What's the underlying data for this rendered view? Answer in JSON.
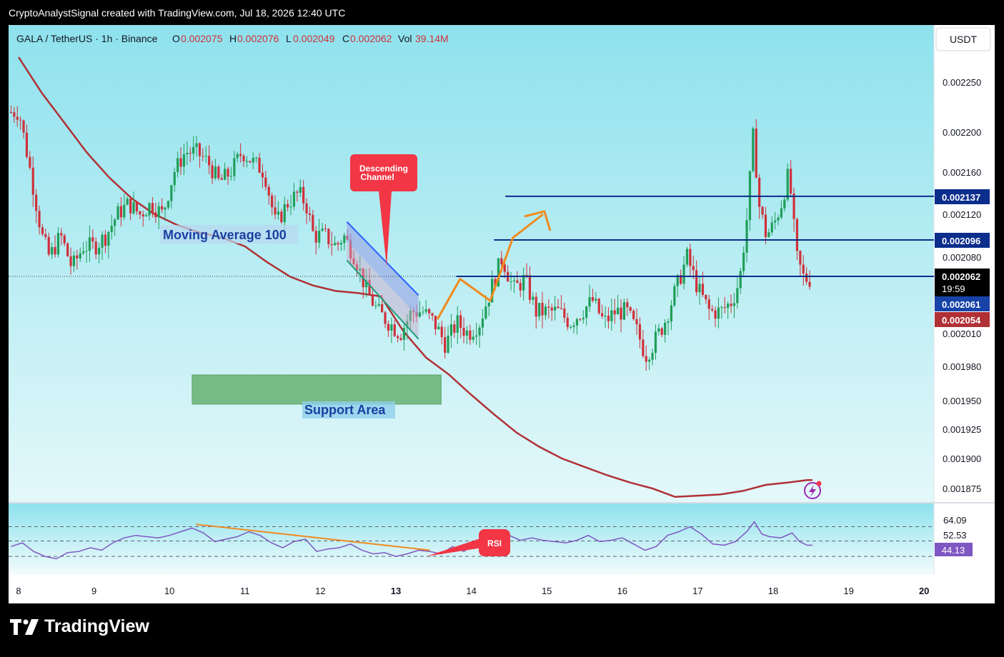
{
  "header": {
    "title": "CryptoAnalystSignal created with TradingView.com, Jul 18, 2026 12:40 UTC"
  },
  "legend": {
    "symbol": "GALA / TetherUS · 1h · Binance",
    "o_label": "O",
    "o_value": "0.002075",
    "h_label": "H",
    "h_value": "0.002076",
    "l_label": "L",
    "l_value": "0.002049",
    "c_label": "C",
    "c_value": "0.002062",
    "vol_label": "Vol",
    "vol_value": "39.14M"
  },
  "currency_button": "USDT",
  "brand": {
    "name": "TradingView"
  },
  "colors": {
    "bg_top": "#8ee2ed",
    "bg_bottom": "#e4f8fa",
    "bull": "#1f9e58",
    "bear": "#d0303a",
    "ma": "#b03035",
    "level": "#0b2d8c",
    "arrow": "#f08a1e",
    "rsi": "#7e57c2",
    "callout": "#f23645"
  },
  "annotations": {
    "moving_average": "Moving Average 100",
    "support_area": "Support Area",
    "descending_channel_line1": "Descending",
    "descending_channel_line2": "Channel",
    "rsi": "RSI"
  },
  "chart_data": {
    "type": "candlestick",
    "y_axis": {
      "range": [
        0.00186,
        0.00228
      ],
      "ticks": [
        "0.002250",
        "0.002200",
        "0.002160",
        "0.002120",
        "0.002080",
        "0.002010",
        "0.001980",
        "0.001950",
        "0.001925",
        "0.001900",
        "0.001875"
      ]
    },
    "x_axis": {
      "range_days": [
        7.9,
        20.05
      ],
      "ticks": [
        {
          "label": "8",
          "x": 8,
          "bold": false
        },
        {
          "label": "9",
          "x": 9,
          "bold": false
        },
        {
          "label": "10",
          "x": 10,
          "bold": false
        },
        {
          "label": "11",
          "x": 11,
          "bold": false
        },
        {
          "label": "12",
          "x": 12,
          "bold": false
        },
        {
          "label": "13",
          "x": 13,
          "bold": true
        },
        {
          "label": "14",
          "x": 14,
          "bold": false
        },
        {
          "label": "15",
          "x": 15,
          "bold": false
        },
        {
          "label": "16",
          "x": 16,
          "bold": false
        },
        {
          "label": "17",
          "x": 17,
          "bold": false
        },
        {
          "label": "18",
          "x": 18,
          "bold": false
        },
        {
          "label": "19",
          "x": 19,
          "bold": false
        },
        {
          "label": "20",
          "x": 20,
          "bold": true
        }
      ]
    },
    "price_path": [
      [
        7.9,
        0.00222
      ],
      [
        8.05,
        0.00222
      ],
      [
        8.15,
        0.00218
      ],
      [
        8.25,
        0.00214
      ],
      [
        8.35,
        0.0021
      ],
      [
        8.45,
        0.00208
      ],
      [
        8.6,
        0.0021
      ],
      [
        8.75,
        0.00207
      ],
      [
        8.9,
        0.00209
      ],
      [
        9.05,
        0.00209
      ],
      [
        9.2,
        0.0021
      ],
      [
        9.35,
        0.00212
      ],
      [
        9.5,
        0.00213
      ],
      [
        9.65,
        0.00212
      ],
      [
        9.8,
        0.00213
      ],
      [
        9.95,
        0.00212
      ],
      [
        10.1,
        0.00216
      ],
      [
        10.25,
        0.00218
      ],
      [
        10.4,
        0.00218
      ],
      [
        10.55,
        0.00217
      ],
      [
        10.7,
        0.00215
      ],
      [
        10.85,
        0.00216
      ],
      [
        11.0,
        0.00218
      ],
      [
        11.15,
        0.00217
      ],
      [
        11.3,
        0.00216
      ],
      [
        11.45,
        0.00211
      ],
      [
        11.6,
        0.00213
      ],
      [
        11.75,
        0.00214
      ],
      [
        11.85,
        0.00213
      ],
      [
        11.95,
        0.0021
      ],
      [
        12.1,
        0.0021
      ],
      [
        12.25,
        0.00209
      ],
      [
        12.35,
        0.0021
      ],
      [
        12.5,
        0.00208
      ],
      [
        12.65,
        0.00205
      ],
      [
        12.8,
        0.00203
      ],
      [
        12.95,
        0.00202
      ],
      [
        13.1,
        0.00201
      ],
      [
        13.25,
        0.00203
      ],
      [
        13.4,
        0.00203
      ],
      [
        13.55,
        0.00202
      ],
      [
        13.7,
        0.002
      ],
      [
        13.85,
        0.00202
      ],
      [
        14.0,
        0.00201
      ],
      [
        14.15,
        0.00202
      ],
      [
        14.3,
        0.00205
      ],
      [
        14.45,
        0.00208
      ],
      [
        14.6,
        0.00205
      ],
      [
        14.75,
        0.00206
      ],
      [
        14.9,
        0.00203
      ],
      [
        15.05,
        0.00203
      ],
      [
        15.2,
        0.00203
      ],
      [
        15.35,
        0.00202
      ],
      [
        15.5,
        0.00203
      ],
      [
        15.65,
        0.00204
      ],
      [
        15.8,
        0.00202
      ],
      [
        15.95,
        0.00203
      ],
      [
        16.1,
        0.00203
      ],
      [
        16.25,
        0.00201
      ],
      [
        16.35,
        0.00199
      ],
      [
        16.45,
        0.002
      ],
      [
        16.6,
        0.00202
      ],
      [
        16.75,
        0.00205
      ],
      [
        16.9,
        0.00208
      ],
      [
        17.05,
        0.00205
      ],
      [
        17.2,
        0.00203
      ],
      [
        17.35,
        0.00203
      ],
      [
        17.5,
        0.00204
      ],
      [
        17.6,
        0.00206
      ],
      [
        17.7,
        0.00212
      ],
      [
        17.78,
        0.0022
      ],
      [
        17.85,
        0.00213
      ],
      [
        17.95,
        0.0021
      ],
      [
        18.05,
        0.00211
      ],
      [
        18.15,
        0.00213
      ],
      [
        18.25,
        0.00216
      ],
      [
        18.35,
        0.00208
      ],
      [
        18.45,
        0.00206
      ],
      [
        18.52,
        0.00206
      ]
    ],
    "moving_average_100": [
      [
        8.0,
        0.002275
      ],
      [
        8.3,
        0.00224
      ],
      [
        8.6,
        0.00221
      ],
      [
        8.9,
        0.00218
      ],
      [
        9.2,
        0.002155
      ],
      [
        9.5,
        0.002135
      ],
      [
        9.8,
        0.00212
      ],
      [
        10.1,
        0.00211
      ],
      [
        10.4,
        0.002103
      ],
      [
        10.7,
        0.002098
      ],
      [
        11.0,
        0.00209
      ],
      [
        11.3,
        0.002075
      ],
      [
        11.6,
        0.002062
      ],
      [
        11.9,
        0.002054
      ],
      [
        12.2,
        0.002049
      ],
      [
        12.5,
        0.002047
      ],
      [
        12.8,
        0.002044
      ],
      [
        13.1,
        0.002032
      ],
      [
        13.4,
        0.002008
      ],
      [
        13.7,
        0.001993
      ],
      [
        14.0,
        0.001975
      ],
      [
        14.3,
        0.001958
      ],
      [
        14.6,
        0.001942
      ],
      [
        14.9,
        0.00193
      ],
      [
        15.2,
        0.00192
      ],
      [
        15.5,
        0.001913
      ],
      [
        15.8,
        0.001906
      ],
      [
        16.1,
        0.0019
      ],
      [
        16.4,
        0.001895
      ],
      [
        16.7,
        0.001888
      ],
      [
        17.0,
        0.001889
      ],
      [
        17.3,
        0.00189
      ],
      [
        17.6,
        0.001893
      ],
      [
        17.9,
        0.001898
      ],
      [
        18.2,
        0.0019
      ],
      [
        18.45,
        0.001902
      ],
      [
        18.52,
        0.001902
      ]
    ],
    "price_labels": [
      {
        "value": "0.002137",
        "price": 0.002137,
        "kind": "level"
      },
      {
        "value": "0.002096",
        "price": 0.002096,
        "kind": "level"
      },
      {
        "value": "0.002062",
        "price": 0.002062,
        "kind": "current",
        "sub": "19:59"
      },
      {
        "value": "0.002061",
        "price": 0.00203,
        "kind": "blue"
      },
      {
        "value": "0.002054",
        "price": 0.00201,
        "kind": "ma"
      }
    ],
    "horizontal_levels": [
      {
        "price": 0.002137,
        "x_start": 14.45
      },
      {
        "price": 0.002096,
        "x_start": 14.3
      }
    ],
    "current_price_line": {
      "price": 0.002062
    },
    "support_area": {
      "x": [
        10.3,
        13.6
      ],
      "y": [
        0.001935,
        0.00196
      ]
    },
    "rsi": {
      "ticks": [
        "64.09",
        "52.53"
      ],
      "current": "44.13",
      "range": [
        25,
        80
      ],
      "bands": [
        64.09,
        52.53,
        40
      ],
      "values": [
        [
          7.9,
          48
        ],
        [
          8.05,
          51
        ],
        [
          8.2,
          44
        ],
        [
          8.35,
          40
        ],
        [
          8.5,
          38
        ],
        [
          8.65,
          43
        ],
        [
          8.8,
          44
        ],
        [
          8.95,
          47
        ],
        [
          9.1,
          45
        ],
        [
          9.25,
          51
        ],
        [
          9.4,
          55
        ],
        [
          9.55,
          57
        ],
        [
          9.7,
          56
        ],
        [
          9.85,
          55
        ],
        [
          10.0,
          57
        ],
        [
          10.15,
          60
        ],
        [
          10.3,
          63
        ],
        [
          10.45,
          59
        ],
        [
          10.6,
          52
        ],
        [
          10.75,
          54
        ],
        [
          10.9,
          56
        ],
        [
          11.05,
          60
        ],
        [
          11.2,
          57
        ],
        [
          11.35,
          51
        ],
        [
          11.5,
          47
        ],
        [
          11.65,
          52
        ],
        [
          11.8,
          54
        ],
        [
          11.95,
          44
        ],
        [
          12.1,
          46
        ],
        [
          12.25,
          47
        ],
        [
          12.4,
          50
        ],
        [
          12.55,
          45
        ],
        [
          12.7,
          42
        ],
        [
          12.85,
          43
        ],
        [
          13.0,
          40
        ],
        [
          13.15,
          42
        ],
        [
          13.3,
          45
        ],
        [
          13.45,
          44
        ],
        [
          13.6,
          42
        ],
        [
          13.75,
          48
        ],
        [
          13.9,
          44
        ],
        [
          14.05,
          50
        ],
        [
          14.2,
          52
        ],
        [
          14.35,
          55
        ],
        [
          14.5,
          57
        ],
        [
          14.65,
          53
        ],
        [
          14.8,
          55
        ],
        [
          14.95,
          53
        ],
        [
          15.1,
          52
        ],
        [
          15.25,
          51
        ],
        [
          15.4,
          53
        ],
        [
          15.55,
          57
        ],
        [
          15.7,
          52
        ],
        [
          15.85,
          53
        ],
        [
          16.0,
          55
        ],
        [
          16.15,
          50
        ],
        [
          16.3,
          45
        ],
        [
          16.45,
          48
        ],
        [
          16.6,
          57
        ],
        [
          16.75,
          60
        ],
        [
          16.9,
          64
        ],
        [
          17.05,
          58
        ],
        [
          17.2,
          50
        ],
        [
          17.35,
          49
        ],
        [
          17.5,
          52
        ],
        [
          17.65,
          60
        ],
        [
          17.75,
          68
        ],
        [
          17.85,
          58
        ],
        [
          17.95,
          56
        ],
        [
          18.1,
          55
        ],
        [
          18.25,
          59
        ],
        [
          18.35,
          52
        ],
        [
          18.45,
          49
        ],
        [
          18.52,
          49
        ]
      ],
      "divergence_line": {
        "from": [
          10.35,
          66
        ],
        "to": [
          13.45,
          45
        ]
      }
    },
    "channel": {
      "upper": [
        [
          12.35,
          0.002113
        ],
        [
          13.3,
          0.002045
        ]
      ],
      "lower": [
        [
          12.35,
          0.002077
        ],
        [
          13.3,
          0.002005
        ]
      ]
    },
    "path_arrow": [
      [
        13.55,
        0.002023
      ],
      [
        13.85,
        0.00206
      ],
      [
        14.25,
        0.00204
      ],
      [
        14.55,
        0.002098
      ],
      [
        14.95,
        0.00212
      ]
    ]
  }
}
